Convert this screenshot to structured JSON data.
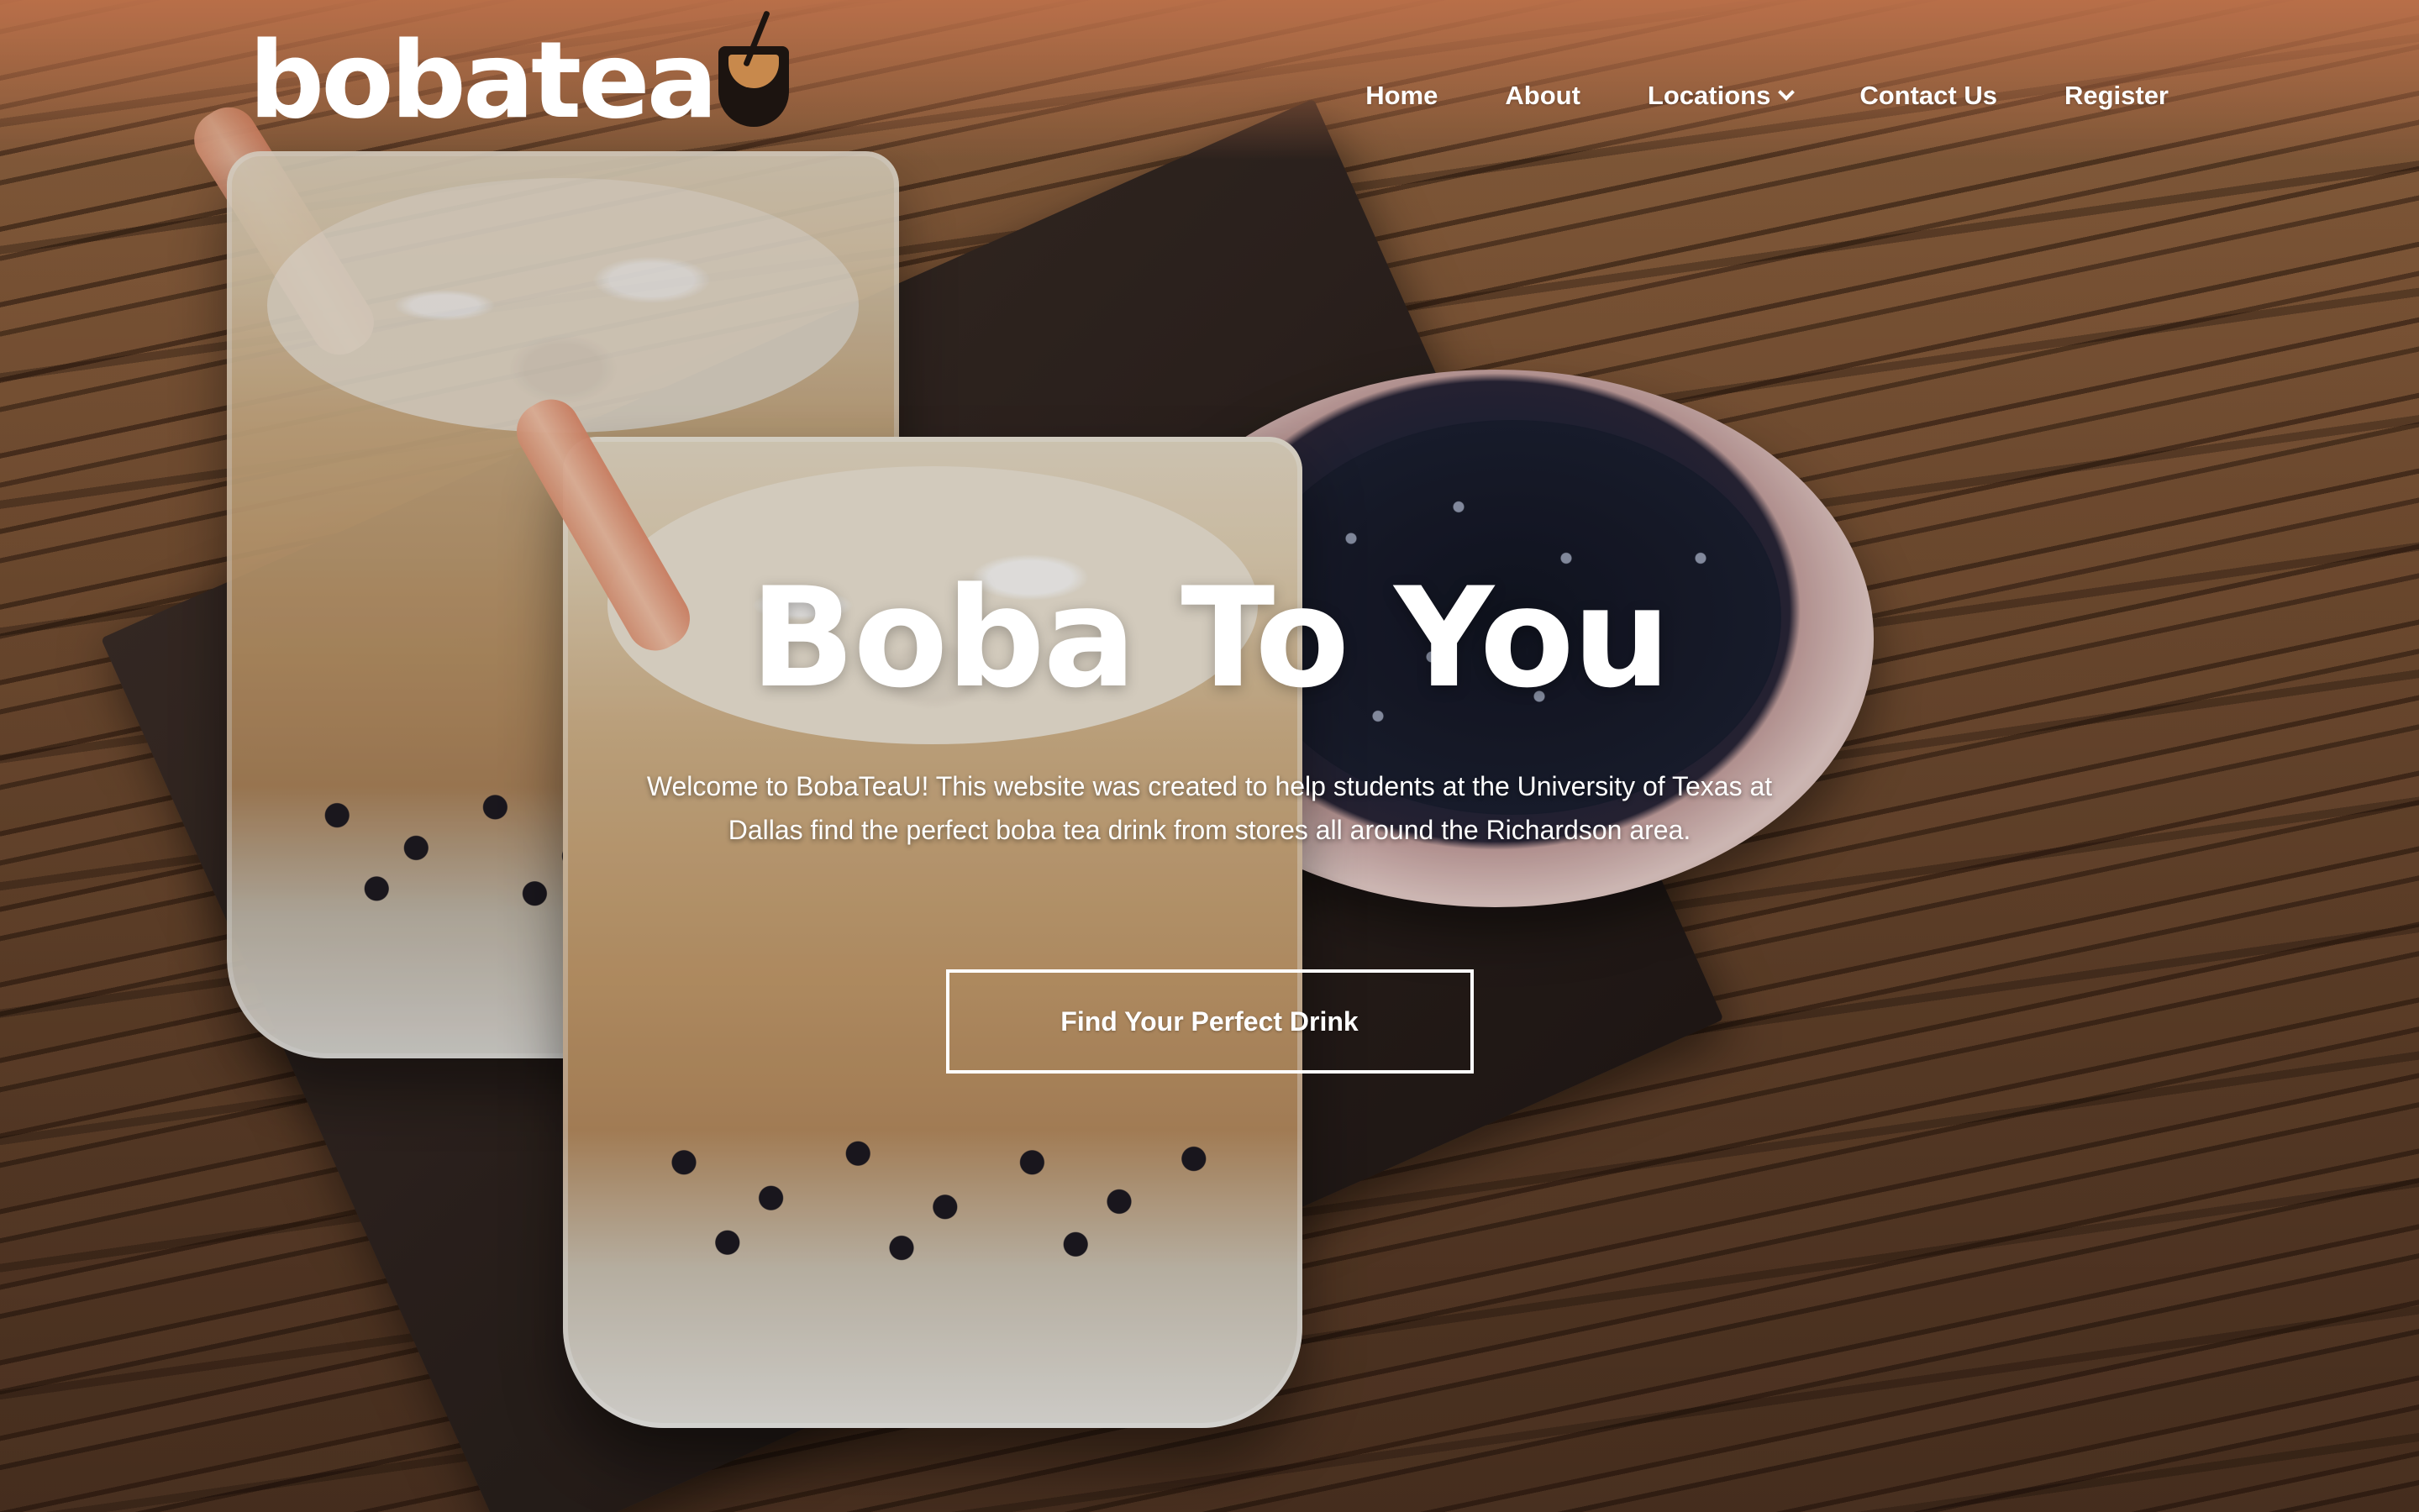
{
  "brand": {
    "logo_text": "bobatea",
    "logo_icon": "boba-cup-icon"
  },
  "nav": {
    "items": [
      {
        "label": "Home"
      },
      {
        "label": "About"
      },
      {
        "label": "Locations",
        "icon": "chevron-down-icon"
      },
      {
        "label": "Contact Us"
      },
      {
        "label": "Register"
      }
    ]
  },
  "hero": {
    "title": "Boba To You",
    "subtitle": "Welcome to BobaTeaU! This website was created to help students at the University of Texas at Dallas find the perfect boba tea drink from stores all around the Richardson area.",
    "cta_label": "Find Your Perfect Drink"
  },
  "colors": {
    "header_glow": "#d68054",
    "text": "#ffffff"
  }
}
